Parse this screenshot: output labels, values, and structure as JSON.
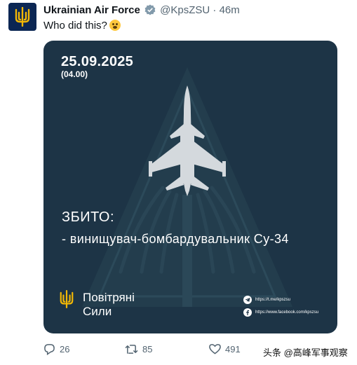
{
  "tweet": {
    "author_name": "Ukrainian Air Force",
    "handle": "@KpsZSU",
    "time_ago": "46m",
    "separator": "·",
    "text": "Who did this?"
  },
  "card": {
    "date": "25.09.2025",
    "time": "(04.00)",
    "headline": "ЗБИТО:",
    "detail": "- винищувач-бомбардувальник Су-34",
    "brand_line1": "Повітряні",
    "brand_line2": "Сили",
    "telegram_link": "https://t.me/kpszsu",
    "facebook_link": "https://www.facebook.com/kpszsu",
    "background_color": "#1d3446"
  },
  "actions": {
    "replies": "26",
    "retweets": "85",
    "likes": "491"
  },
  "watermark": "头条 @高峰军事观察",
  "colors": {
    "avatar_bg": "#0b2653",
    "trident": "#f2b705",
    "verified": "#829aab",
    "meta_gray": "#536471"
  }
}
